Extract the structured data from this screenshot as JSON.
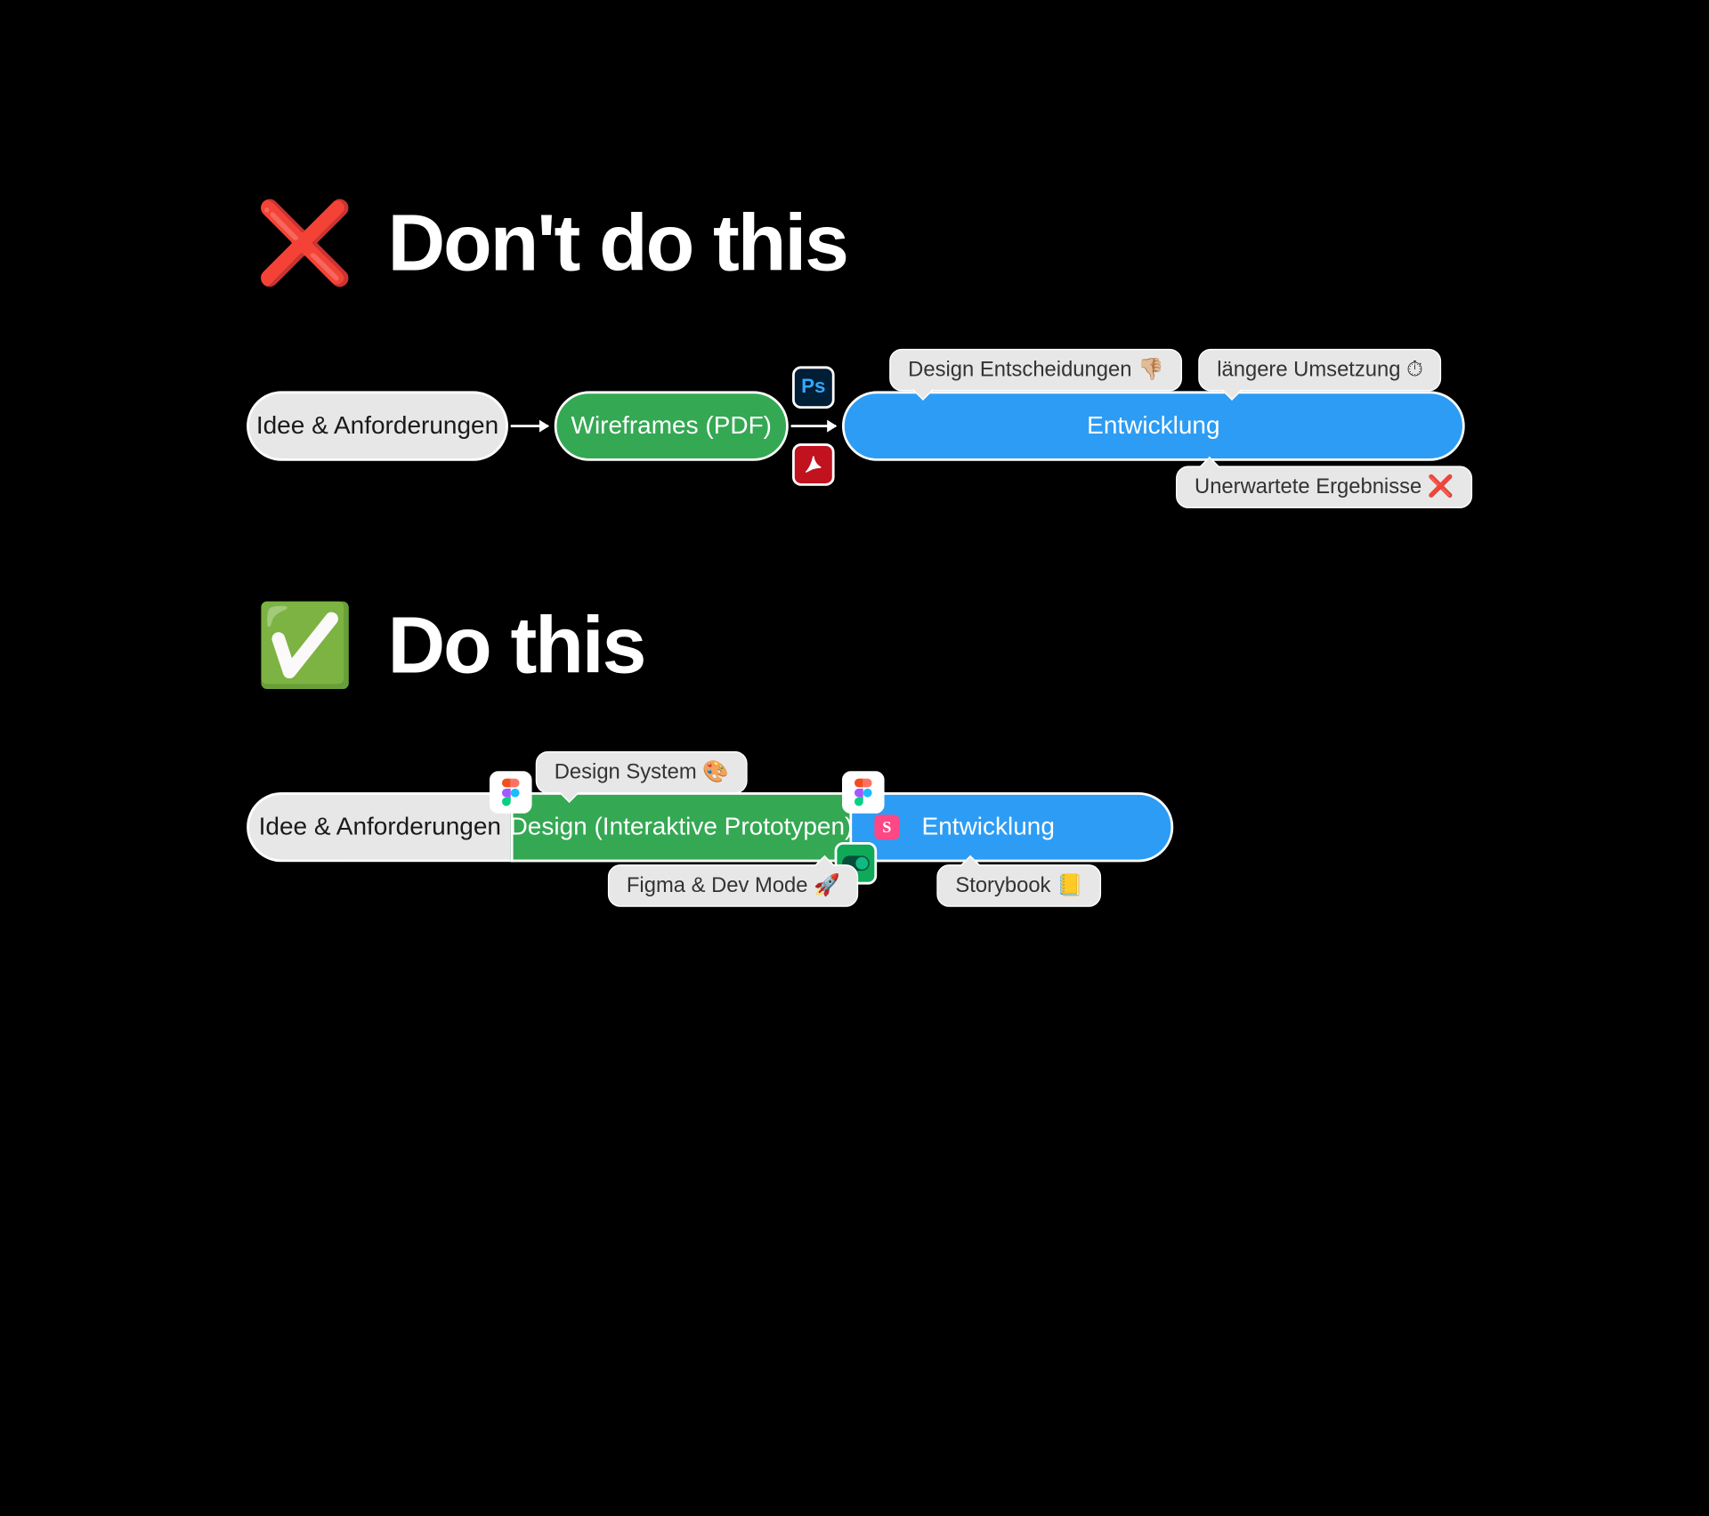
{
  "dont": {
    "emoji": "❌",
    "title": "Don't do this",
    "steps": {
      "idea": "Idee & Anforderungen",
      "wireframes": "Wireframes (PDF)",
      "dev": "Entwicklung"
    },
    "annotations": {
      "decisions": "Design Entscheidungen 👎🏼",
      "longer": "längere Umsetzung ⏱",
      "unexpected": "Unerwartete Ergebnisse ❌"
    },
    "icons": {
      "ps": "Ps",
      "pdf": "PDF"
    }
  },
  "do": {
    "emoji": "✅",
    "title": "Do this",
    "steps": {
      "idea": "Idee & Anforderungen",
      "design": "Design (Interaktive Prototypen)",
      "dev": "Entwicklung"
    },
    "annotations": {
      "designsystem": "Design System 🎨",
      "figmadev": "Figma & Dev Mode 🚀",
      "storybook": "Storybook 📒"
    },
    "icons": {
      "figma": "Figma",
      "storybook": "S",
      "devmode": "Dev Mode"
    }
  }
}
